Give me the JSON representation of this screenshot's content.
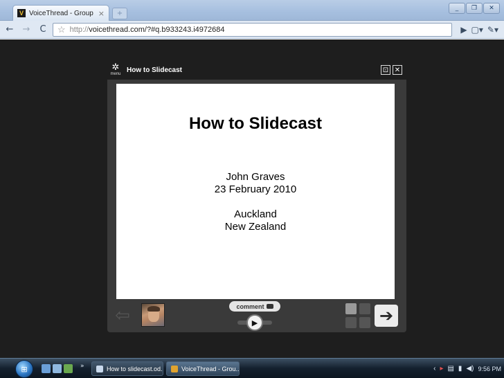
{
  "browser": {
    "tab_title": "VoiceThread - Group con...",
    "tab_favicon_letter": "V",
    "tab_close": "×",
    "address": {
      "scheme": "http://",
      "rest": "voicethread.com/?#q.b933243.i4972684"
    }
  },
  "player": {
    "menu_label": "menu",
    "title": "How to Slidecast",
    "slide": {
      "title": "How to Slidecast",
      "lines": [
        "John Graves",
        "23 February 2010",
        "Auckland",
        "New Zealand"
      ]
    },
    "comment_label": "comment"
  },
  "taskbar": {
    "tasks": [
      {
        "label": "How to slidecast.od...",
        "icon_color": "#c9d9ec"
      },
      {
        "label": "VoiceThread - Grou...",
        "icon_color": "#e0a32e"
      }
    ],
    "clock": "9:56 PM"
  },
  "colors": {
    "page_background": "#1e1e1e",
    "player_frame": "#3a3a3a",
    "slide_background": "#ffffff"
  }
}
